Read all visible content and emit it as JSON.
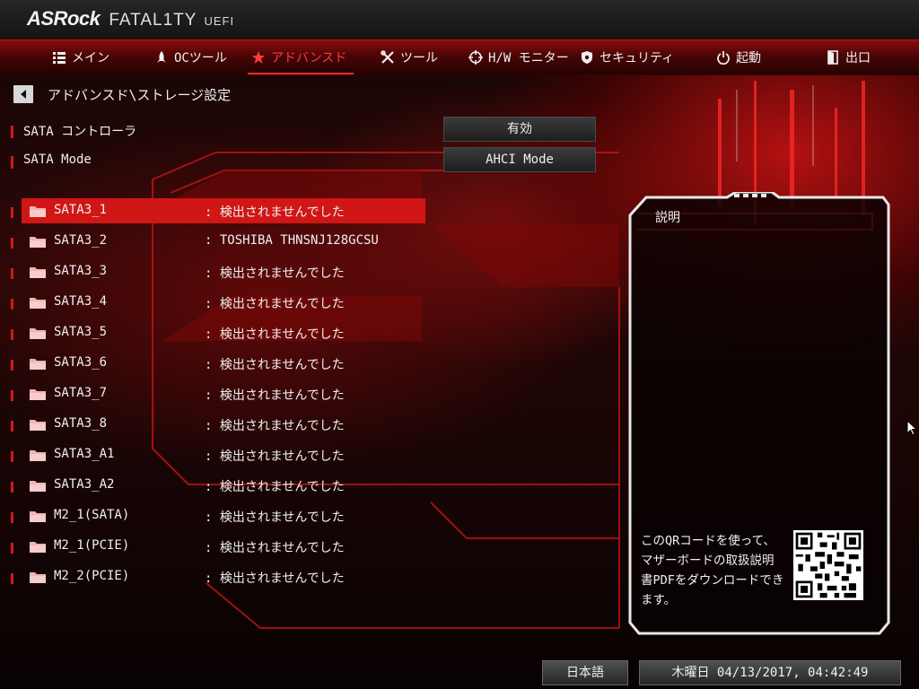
{
  "header": {
    "brand": "ASRock",
    "product_line": "FATAL1TY",
    "uefi": "UEFI"
  },
  "nav": {
    "tabs": [
      {
        "label": "メイン",
        "icon": "list-icon"
      },
      {
        "label": "OCツール",
        "icon": "rocket-icon"
      },
      {
        "label": "アドバンスド",
        "icon": "star-icon",
        "active": true
      },
      {
        "label": "ツール",
        "icon": "tools-icon"
      },
      {
        "label": "H/W モニター",
        "icon": "crosshair-icon"
      },
      {
        "label": "セキュリティ",
        "icon": "shield-icon"
      },
      {
        "label": "起動",
        "icon": "power-icon"
      },
      {
        "label": "出口",
        "icon": "exit-door-icon"
      }
    ]
  },
  "breadcrumb": "アドバンスド\\ストレージ設定",
  "settings": [
    {
      "label": "SATA コントローラ",
      "value": "有効"
    },
    {
      "label": "SATA Mode",
      "value": "AHCI Mode"
    }
  ],
  "devices": [
    {
      "name": "SATA3_1",
      "status": ": 検出されませんでした",
      "selected": true
    },
    {
      "name": "SATA3_2",
      "status": ": TOSHIBA THNSNJ128GCSU"
    },
    {
      "name": "SATA3_3",
      "status": ": 検出されませんでした"
    },
    {
      "name": "SATA3_4",
      "status": ": 検出されませんでした"
    },
    {
      "name": "SATA3_5",
      "status": ": 検出されませんでした"
    },
    {
      "name": "SATA3_6",
      "status": ": 検出されませんでした"
    },
    {
      "name": "SATA3_7",
      "status": ": 検出されませんでした"
    },
    {
      "name": "SATA3_8",
      "status": ": 検出されませんでした"
    },
    {
      "name": "SATA3_A1",
      "status": ": 検出されませんでした"
    },
    {
      "name": "SATA3_A2",
      "status": ": 検出されませんでした"
    },
    {
      "name": "M2_1(SATA)",
      "status": ": 検出されませんでした"
    },
    {
      "name": "M2_1(PCIE)",
      "status": ": 検出されませんでした"
    },
    {
      "name": "M2_2(PCIE)",
      "status": ": 検出されませんでした"
    }
  ],
  "description": {
    "title": "説明",
    "qr_text": "このQRコードを使って、マザーボードの取扱説明書PDFをダウンロードできます。"
  },
  "footer": {
    "language": "日本語",
    "datetime": "木曜日 04/13/2017, 04:42:49"
  },
  "colors": {
    "accent": "#d11616",
    "active_tab": "#ff3b3b"
  }
}
